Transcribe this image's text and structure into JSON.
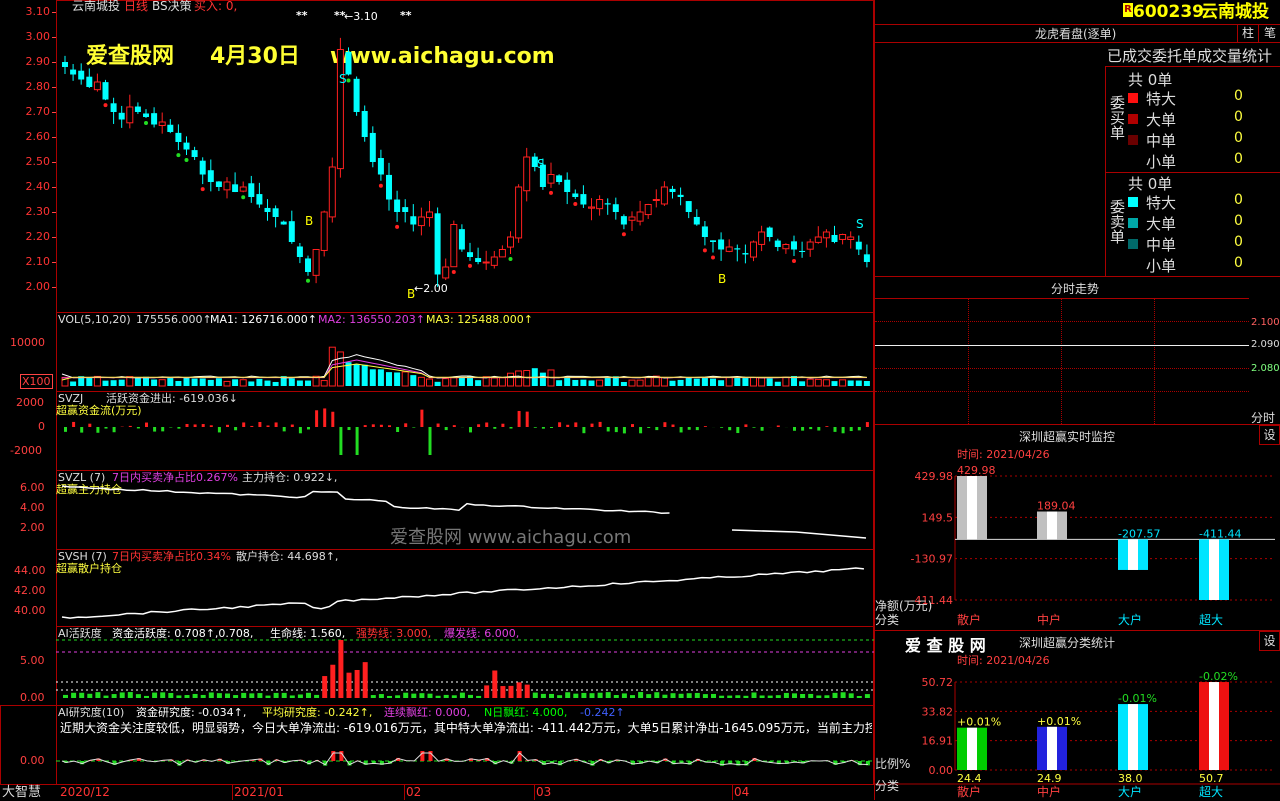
{
  "stock": {
    "code": "600239",
    "name": "云南城投",
    "badge": "R"
  },
  "main_chart": {
    "title": "云南城投",
    "period": "日线",
    "indicator": "BS决策",
    "buy_label": "买入: 0,",
    "watermark_site": "爱查股网",
    "watermark_date": "4月30日",
    "watermark_url": "www.aichagu.com",
    "price_labels": [
      "3.10",
      "3.00",
      "2.90",
      "2.80",
      "2.70",
      "2.60",
      "2.50",
      "2.40",
      "2.30",
      "2.20",
      "2.10",
      "2.00"
    ],
    "high_marker": "←3.10",
    "low_marker": "←2.00",
    "star_marks": [
      "**",
      "**",
      "**"
    ],
    "b_label": "B",
    "s_label": "S"
  },
  "vol_panel": {
    "label": "VOL(5,10,20)",
    "vol": "175556.000↑",
    "ma1": "MA1: 126716.000↑",
    "ma2": "MA2: 136550.203↑",
    "ma3": "MA3: 125488.000↑",
    "y_labels": [
      "10000",
      "X100"
    ]
  },
  "svzj_panel": {
    "label": "SVZJ",
    "text": "活跃资金进出: -619.036↓",
    "sub": "超赢资金流(万元)",
    "y_labels": [
      "2000",
      "0",
      "-2000"
    ]
  },
  "svzl_panel": {
    "label": "SVZL (7)",
    "text1": "7日内买卖净占比0.267%",
    "text2": "主力持仓: 0.922↓,",
    "sub": "超赢主力持仓",
    "y_labels": [
      "6.00",
      "4.00",
      "2.00"
    ],
    "watermark": "爱查股网  www.aichagu.com"
  },
  "svsh_panel": {
    "label": "SVSH (7)",
    "text1": "7日内买卖净占比0.34%",
    "text2": "散户持仓: 44.698↑,",
    "sub": "超赢散户持仓",
    "y_labels": [
      "44.00",
      "42.00",
      "40.00"
    ]
  },
  "ai_active": {
    "label": "AI活跃度",
    "text1": "资金活跃度: 0.708↑,0.708,",
    "text2": "生命线: 1.560,",
    "text3": "强势线: 3.000,",
    "text4": "爆发线: 6.000,",
    "y_labels": [
      "5.00",
      "0.00"
    ]
  },
  "ai_research": {
    "label": "AI研究度(10)",
    "text1": "资金研究度: -0.034↑,",
    "text2": "平均研究度: -0.242↑,",
    "text3": "连续飘红: 0.000,",
    "text4": "N日飘红: 4.000,",
    "text5": "-0.242↑",
    "comment": "近期大资金关注度较低，明显弱势，今日大单净流出: -619.016万元，其中特大单净流出: -411.442万元，大单5日累计净出-1645.095万元，当前主力控盘较",
    "y_labels": [
      "0.00"
    ]
  },
  "x_axis": {
    "labels": [
      "2020/12",
      "2021/01",
      "02",
      "03",
      "04"
    ],
    "corner": "大智慧"
  },
  "right_panel": {
    "top_buttons": [
      "柱",
      "笔"
    ],
    "dragon_title": "龙虎看盘(逐单)",
    "order_title": "已成交委托单成交量统计",
    "buy_group": {
      "label": "委买单",
      "total": "共 0单",
      "rows": [
        {
          "name": "特大",
          "value": "0"
        },
        {
          "name": "大单",
          "value": "0"
        },
        {
          "name": "中单",
          "value": "0"
        },
        {
          "name": "小单",
          "value": "0"
        }
      ]
    },
    "sell_group": {
      "label": "委卖单",
      "total": "共 0单",
      "rows": [
        {
          "name": "特大",
          "value": "0"
        },
        {
          "name": "大单",
          "value": "0"
        },
        {
          "name": "中单",
          "value": "0"
        },
        {
          "name": "小单",
          "value": "0"
        }
      ]
    },
    "fenshi_title": "分时走势",
    "fenshi_prices": [
      "2.100",
      "2.090",
      "2.080"
    ],
    "fenshi_corner": "分时",
    "monitor_title": "深圳超赢实时监控",
    "monitor_btn": "设",
    "monitor_time": "时间: 2021/04/26",
    "monitor_y": [
      "429.98",
      "149.5",
      "-130.97",
      "-411.44"
    ],
    "monitor_unit": "净额(万元)",
    "monitor_cat_label": "分类",
    "stats_title": "深圳超赢分类统计",
    "stats_logo": "爱 查 股 网",
    "stats_btn": "设",
    "stats_time": "时间: 2021/04/26",
    "stats_y": [
      "50.72",
      "33.82",
      "16.91",
      "0.00"
    ],
    "stats_unit": "比例%",
    "stats_cat_label": "分类",
    "categories": [
      "散户",
      "中户",
      "大户",
      "超大"
    ]
  },
  "chart_data": [
    {
      "type": "bar",
      "title": "深圳超赢实时监控",
      "categories": [
        "散户",
        "中户",
        "大户",
        "超大"
      ],
      "values": [
        429.98,
        189.04,
        -207.57,
        -411.44
      ],
      "value_labels": [
        "429.98",
        "189.04",
        "-207.57",
        "-411.44"
      ],
      "ylabel": "净额(万元)",
      "ylim": [
        -411.44,
        429.98
      ],
      "colors": [
        "#c0c0c0",
        "#c0c0c0",
        "#00e5ff",
        "#00e5ff"
      ]
    },
    {
      "type": "bar",
      "title": "深圳超赢分类统计",
      "categories": [
        "散户",
        "中户",
        "大户",
        "超大"
      ],
      "values": [
        24.4,
        24.9,
        38.0,
        50.7
      ],
      "value_labels": [
        "24.4",
        "24.9",
        "38.0",
        "50.7"
      ],
      "top_labels": [
        "+0.01%",
        "+0.01%",
        "-0.01%",
        "-0.02%"
      ],
      "ylabel": "比例%",
      "ylim": [
        0,
        50.72
      ],
      "colors": [
        "#00cc00",
        "#2222dd",
        "#00e5ff",
        "#ee1111"
      ]
    }
  ]
}
